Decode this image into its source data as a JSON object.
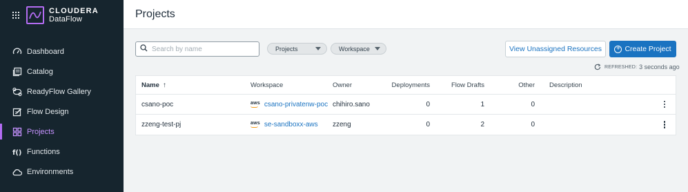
{
  "brand": {
    "name": "CLOUDERA",
    "product": "DataFlow"
  },
  "nav": [
    {
      "label": "Dashboard",
      "icon": "dashboard-icon",
      "active": false
    },
    {
      "label": "Catalog",
      "icon": "catalog-icon",
      "active": false
    },
    {
      "label": "ReadyFlow Gallery",
      "icon": "readyflow-icon",
      "active": false
    },
    {
      "label": "Flow Design",
      "icon": "flow-design-icon",
      "active": false
    },
    {
      "label": "Projects",
      "icon": "projects-icon",
      "active": true
    },
    {
      "label": "Functions",
      "icon": "functions-icon",
      "active": false
    },
    {
      "label": "Environments",
      "icon": "cloud-icon",
      "active": false
    }
  ],
  "page": {
    "title": "Projects"
  },
  "search": {
    "placeholder": "Search by name",
    "value": ""
  },
  "filters": {
    "projects": "Projects",
    "workspace": "Workspace"
  },
  "actions": {
    "unassigned": "View Unassigned Resources",
    "create": "Create Project"
  },
  "refresh": {
    "label": "REFRESHED:",
    "time": "3 seconds ago"
  },
  "table": {
    "headers": {
      "name": "Name",
      "workspace": "Workspace",
      "owner": "Owner",
      "deployments": "Deployments",
      "flow_drafts": "Flow Drafts",
      "other": "Other",
      "description": "Description"
    },
    "rows": [
      {
        "name": "csano-poc",
        "provider": "aws",
        "workspace": "csano-privatenw-poc",
        "owner": "chihiro.sano",
        "deployments": "0",
        "flow_drafts": "1",
        "other": "0",
        "description": ""
      },
      {
        "name": "zzeng-test-pj",
        "provider": "aws",
        "workspace": "se-sandboxx-aws",
        "owner": "zzeng",
        "deployments": "0",
        "flow_drafts": "2",
        "other": "0",
        "description": ""
      }
    ]
  },
  "colors": {
    "sidebar": "#16252e",
    "accent": "#b36cf2",
    "primary": "#1a73c1"
  }
}
